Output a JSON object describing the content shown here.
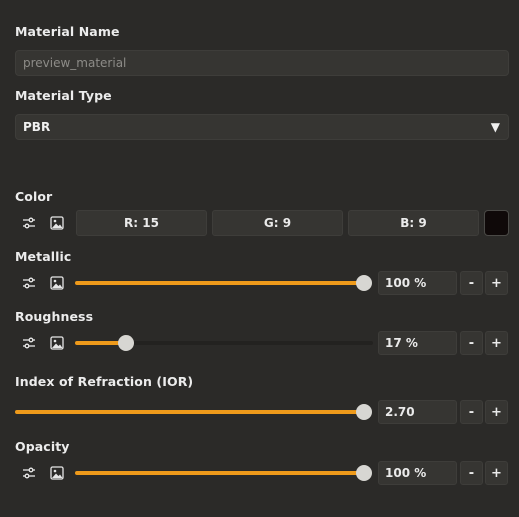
{
  "material_name": {
    "label": "Material Name",
    "value": "preview_material"
  },
  "material_type": {
    "label": "Material Type",
    "selected": "PBR",
    "arrow": "▼"
  },
  "color": {
    "label": "Color",
    "r_text": "R: 15",
    "g_text": "G:  9",
    "b_text": "B:  9",
    "swatch": "#0f0909"
  },
  "metallic": {
    "label": "Metallic",
    "value_text": "100 %",
    "level": 1.0
  },
  "roughness": {
    "label": "Roughness",
    "value_text": "17 %",
    "level": 0.17
  },
  "ior": {
    "label": "Index of Refraction (IOR)",
    "value_text": "2.70",
    "level": 1.0
  },
  "opacity": {
    "label": "Opacity",
    "value_text": "100 %",
    "level": 1.0
  },
  "stepper": {
    "minus": "-",
    "plus": "+"
  },
  "accent_color": "#ee9a1b",
  "icons": {
    "adjust": "sliders-icon",
    "texture": "image-icon"
  }
}
